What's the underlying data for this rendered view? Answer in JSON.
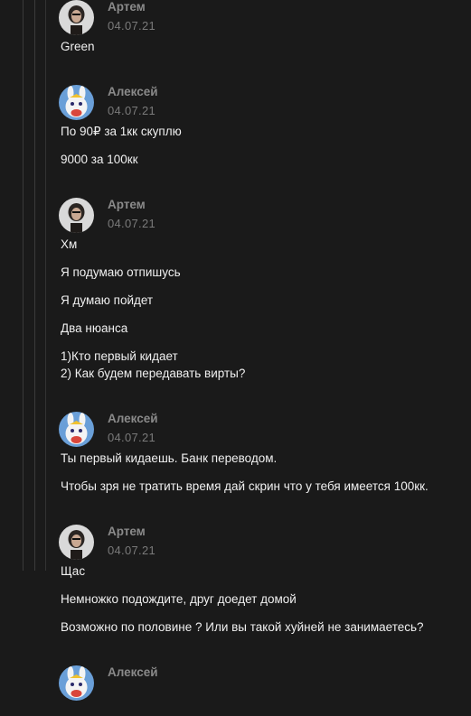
{
  "messages": [
    {
      "author": "Артем",
      "date": "04.07.21",
      "avatar": "avatar-artem",
      "paragraphs": [
        "Green"
      ]
    },
    {
      "author": "Алексей",
      "date": "04.07.21",
      "avatar": "avatar-aleksey",
      "paragraphs": [
        "По 90₽ за 1кк скуплю",
        "9000 за 100кк"
      ]
    },
    {
      "author": "Артем",
      "date": "04.07.21",
      "avatar": "avatar-artem",
      "paragraphs": [
        "Хм",
        "Я подумаю отпишусь",
        "Я думаю пойдет",
        "Два нюанса",
        "1)Кто первый кидает\n2) Как будем передавать вирты?"
      ]
    },
    {
      "author": "Алексей",
      "date": "04.07.21",
      "avatar": "avatar-aleksey",
      "paragraphs": [
        "Ты первый кидаешь. Банк переводом.",
        "Чтобы зря не тратить время дай скрин что у тебя имеется 100кк."
      ]
    },
    {
      "author": "Артем",
      "date": "04.07.21",
      "avatar": "avatar-artem",
      "paragraphs": [
        "Щас",
        "Немножко подождите, друг доедет домой",
        "Возможно по половине ? Или вы такой хуйней не занимаетесь?"
      ]
    },
    {
      "author": "Алексей",
      "date": "",
      "avatar": "avatar-aleksey",
      "paragraphs": []
    }
  ],
  "colors": {
    "background": "#1a1a1a",
    "author": "#8a8a8a",
    "date": "#7a7a7a",
    "text": "#f0f0f0",
    "rail": "#3a3a3a"
  }
}
